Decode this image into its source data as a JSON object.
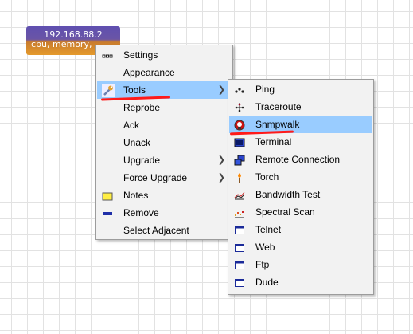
{
  "device": {
    "ip": "192.168.88.2",
    "services": "cpu, memory,"
  },
  "context_menu": {
    "items": [
      {
        "label": "Settings",
        "icon": "dots-icon"
      },
      {
        "label": "Appearance",
        "icon": ""
      },
      {
        "label": "Tools",
        "icon": "wrench-icon",
        "submenu": true,
        "highlighted": true
      },
      {
        "label": "Reprobe",
        "icon": ""
      },
      {
        "label": "Ack",
        "icon": ""
      },
      {
        "label": "Unack",
        "icon": ""
      },
      {
        "label": "Upgrade",
        "icon": "",
        "submenu": true
      },
      {
        "label": "Force Upgrade",
        "icon": "",
        "submenu": true
      },
      {
        "label": "Notes",
        "icon": "note-icon"
      },
      {
        "label": "Remove",
        "icon": "minus-icon"
      },
      {
        "label": "Select Adjacent",
        "icon": ""
      }
    ]
  },
  "tools_submenu": {
    "items": [
      {
        "label": "Ping",
        "icon": "ping-icon"
      },
      {
        "label": "Traceroute",
        "icon": "traceroute-icon"
      },
      {
        "label": "Snmpwalk",
        "icon": "snmpwalk-icon",
        "highlighted": true
      },
      {
        "label": "Terminal",
        "icon": "terminal-icon"
      },
      {
        "label": "Remote Connection",
        "icon": "remote-connection-icon"
      },
      {
        "label": "Torch",
        "icon": "torch-icon"
      },
      {
        "label": "Bandwidth Test",
        "icon": "bandwidth-test-icon"
      },
      {
        "label": "Spectral Scan",
        "icon": "spectral-scan-icon"
      },
      {
        "label": "Telnet",
        "icon": "window-icon"
      },
      {
        "label": "Web",
        "icon": "window-icon"
      },
      {
        "label": "Ftp",
        "icon": "window-icon"
      },
      {
        "label": "Dude",
        "icon": "window-icon"
      }
    ]
  },
  "colors": {
    "highlight": "#99ccff",
    "annotation": "#ff1a1a",
    "menu_bg": "#f2f2f2"
  }
}
